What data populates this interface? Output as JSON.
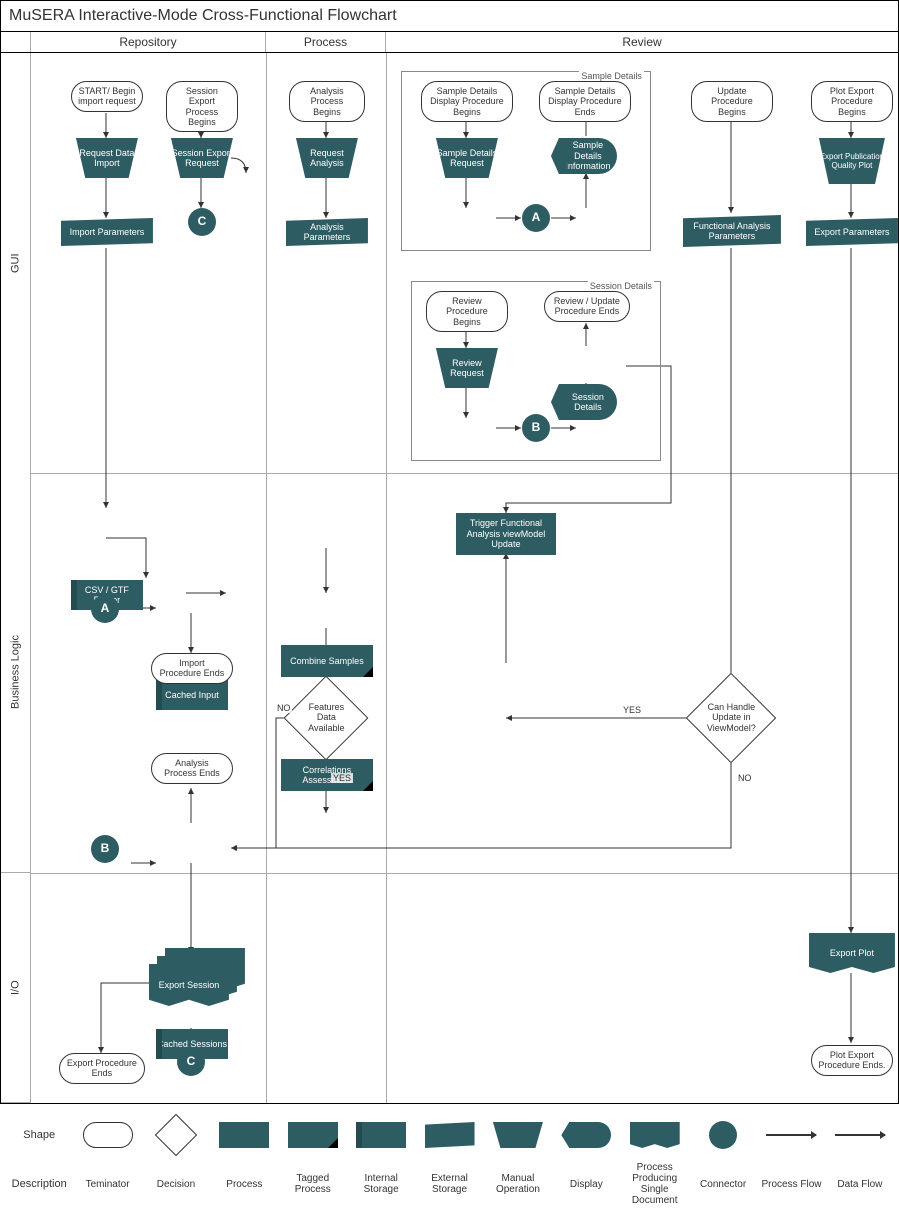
{
  "title": "MuSERA Interactive-Mode Cross-Functional Flowchart",
  "columns": {
    "repository": "Repository",
    "process": "Process",
    "review": "Review"
  },
  "rows": {
    "gui": "GUI",
    "logic": "Business Logic",
    "io": "I/O"
  },
  "gui": {
    "repo": {
      "start_import": "START/ Begin import request",
      "request_data_import": "Request Data Import",
      "import_params": "Import Parameters",
      "session_export_begins": "Session Export Process Begins",
      "session_export_request": "Session Export Request",
      "connector_c": "C"
    },
    "process": {
      "analysis_begins": "Analysis Process Begins",
      "request_analysis": "Request Analysis",
      "analysis_params": "Analysis Parameters"
    },
    "review": {
      "sample_group": "Sample Details",
      "sample_begin": "Sample Details Display Procedure Begins",
      "sample_end": "Sample Details Display Procedure Ends",
      "sample_request": "Sample Details Request",
      "sample_info": "Sample Details Information",
      "connector_a": "A",
      "session_group": "Session Details",
      "review_begin": "Review Procedure Begins",
      "review_end": "Review / Update Procedure Ends",
      "review_request": "Review Request",
      "session_details": "Session Details",
      "connector_b": "B",
      "update_begin": "Update Procedure Begins",
      "func_params": "Functional Analysis Parameters",
      "plot_export_begin": "Plot Export Procedure Begins",
      "export_pub_plot": "Export Publication Quality Plot",
      "export_params": "Export Parameters"
    }
  },
  "logic": {
    "csv_parser": "CSV / GTF Parser",
    "cached_input": "Cached Input",
    "connector_a": "A",
    "import_ends": "Import Procedure Ends",
    "combine_samples": "Combine Samples",
    "correlations": "Correlations Assessment",
    "features_avail": "Features Data Available",
    "analysis_ends": "Analysis Process Ends",
    "cached_sessions": "Cached Sessions",
    "connector_b": "B",
    "trigger_func": "Trigger Functional Analysis viewModel Update",
    "can_handle": "Can Handle Update in ViewModel?",
    "yes": "YES",
    "no": "NO"
  },
  "io": {
    "export_session": "Export Session",
    "connector_c": "C",
    "export_ends": "Export Procedure Ends",
    "export_plot": "Export Plot",
    "plot_export_ends": "Plot Export Procedure Ends."
  },
  "legend": {
    "shape": "Shape",
    "description": "Description",
    "terminator": "Teminator",
    "decision": "Decision",
    "process": "Process",
    "tagged": "Tagged Process",
    "int_storage": "Internal Storage",
    "ext_storage": "External Storage",
    "manual_op": "Manual Operation",
    "display": "Display",
    "doc": "Process Producing Single Document",
    "connector": "Connector",
    "pflow": "Process Flow",
    "dflow": "Data Flow"
  }
}
